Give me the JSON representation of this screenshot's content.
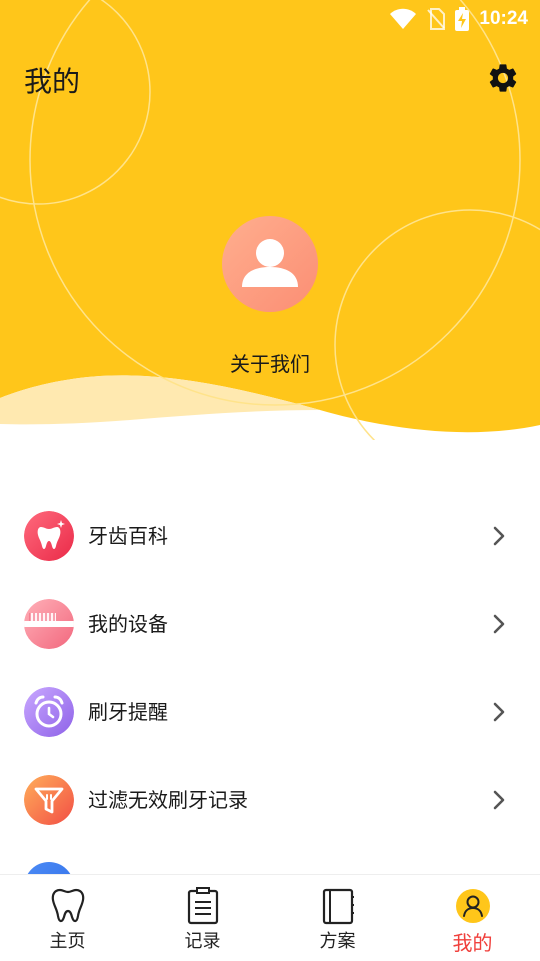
{
  "status_bar": {
    "time": "10:24",
    "icons": [
      "wifi-icon",
      "no-sim-icon",
      "battery-charging-icon"
    ]
  },
  "header": {
    "title": "我的",
    "settings_icon": "gear-icon",
    "about_label": "关于我们",
    "avatar_icon": "user-avatar-icon"
  },
  "menu": {
    "items": [
      {
        "label": "牙齿百科",
        "icon": "tooth-sparkle-icon",
        "color": "#f2455a"
      },
      {
        "label": "我的设备",
        "icon": "toothbrush-icon",
        "color": "#f47a8c"
      },
      {
        "label": "刷牙提醒",
        "icon": "alarm-clock-icon",
        "color": "#a77ef0"
      },
      {
        "label": "过滤无效刷牙记录",
        "icon": "filter-icon",
        "color": "#f7704a"
      }
    ],
    "chevron_icon": "chevron-right-icon"
  },
  "tabbar": {
    "tabs": [
      {
        "label": "主页",
        "icon": "tooth-icon",
        "active": false
      },
      {
        "label": "记录",
        "icon": "clipboard-icon",
        "active": false
      },
      {
        "label": "方案",
        "icon": "notebook-icon",
        "active": false
      },
      {
        "label": "我的",
        "icon": "profile-icon",
        "active": true
      }
    ]
  },
  "colors": {
    "header_yellow": "#ffc61a",
    "wave_light": "#ffe9b0",
    "active_tab": "#f0403c"
  }
}
